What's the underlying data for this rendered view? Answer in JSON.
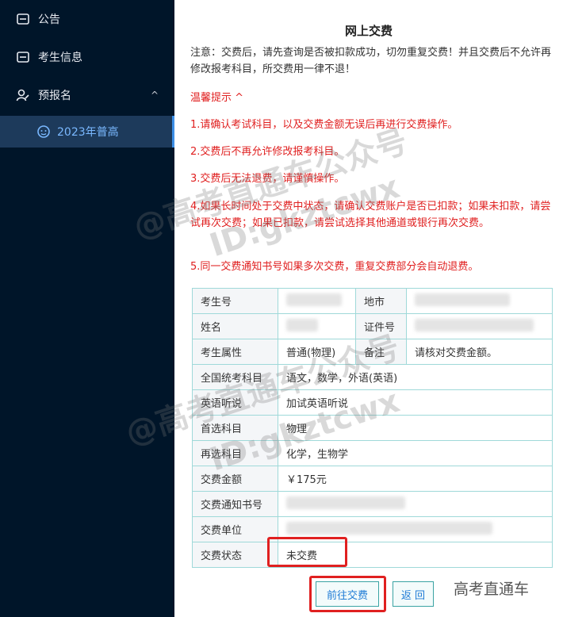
{
  "sidebar": {
    "items": [
      {
        "label": "公告",
        "icon": "announcement-icon"
      },
      {
        "label": "考生信息",
        "icon": "id-card-icon"
      },
      {
        "label": "预报名",
        "icon": "user-edit-icon"
      }
    ],
    "sub_item": {
      "label": "2023年普高",
      "icon": "face-icon"
    }
  },
  "page": {
    "title": "网上交费",
    "notice": "注意：交费后，请先查询是否被扣款成功，切勿重复交费！并且交费后不允许再修改报考科目，所交费用一律不退！",
    "tips_toggle": "温馨提示 ^",
    "tips": [
      "1.请确认考试科目，以及交费金额无误后再进行交费操作。",
      "2.交费后不再允许修改报考科目。",
      "3.交费后无法退费，请谨慎操作。",
      "4.如果长时间处于交费中状态，请确认交费账户是否已扣款；如果未扣款，请尝试再次交费；如果已扣款，请尝试选择其他通道或银行再次交费。",
      "5.同一交费通知书号如果多次交费，重复交费部分会自动退费。"
    ]
  },
  "table": {
    "exam_no_label": "考生号",
    "city_label": "地市",
    "name_label": "姓名",
    "id_label": "证件号",
    "attr_label": "考生属性",
    "attr_value": "普通(物理)",
    "remark_label": "备注",
    "remark_value": "请核对交费金额。",
    "national_label": "全国统考科目",
    "national_value": "语文，数学，外语(英语)",
    "listening_label": "英语听说",
    "listening_value": "加试英语听说",
    "first_label": "首选科目",
    "first_value": "物理",
    "second_label": "再选科目",
    "second_value": "化学，生物学",
    "amount_label": "交费金额",
    "amount_value": "￥175元",
    "notice_no_label": "交费通知书号",
    "unit_label": "交费单位",
    "status_label": "交费状态",
    "status_value": "未交费"
  },
  "buttons": {
    "pay": "前往交费",
    "back": "返 回"
  },
  "watermarks": [
    "@高考直通车公众号",
    "ID:gkztcwx",
    "@高考直通车公众号",
    "ID:gkztcwx"
  ],
  "brand": "高考直通车",
  "colors": {
    "sidebar_bg": "#001529",
    "active_bg": "#1d3a5b",
    "accent_red": "#e02020",
    "table_border": "#9fd9d9",
    "link_blue": "#1f7bd6"
  }
}
